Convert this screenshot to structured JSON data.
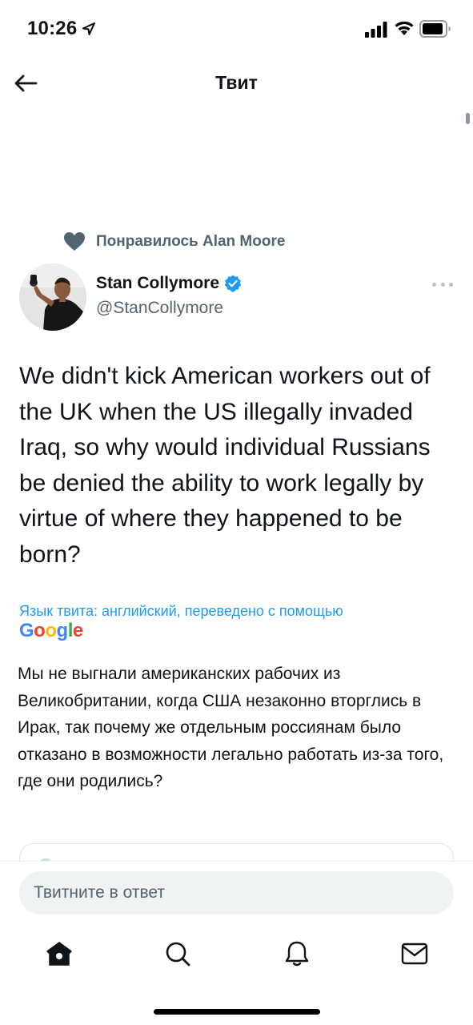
{
  "status_bar": {
    "time": "10:26"
  },
  "header": {
    "title": "Твит"
  },
  "social_context": {
    "liked_text": "Понравилось Alan Moore"
  },
  "author": {
    "name": "Stan Collymore",
    "handle": "@StanCollymore",
    "verified": true
  },
  "tweet": {
    "text": "We didn't kick American workers out of the UK when the US illegally invaded Iraq, so why would individual Russians be denied the ability to work legally by virtue of where they happened to be born?"
  },
  "translation": {
    "label": "Язык твита: английский, переведено с помощью",
    "provider": "Google",
    "text": "Мы не выгнали американских рабочих из Великобритании, когда США незаконно вторглись в Ирак, так почему же отдельным россиянам было отказано в возможности легально работать из-за того, где они родились?"
  },
  "reply": {
    "placeholder": "Твитните в ответ"
  },
  "nav": {
    "items": [
      "home-icon",
      "search-icon",
      "notifications-icon",
      "messages-icon"
    ]
  },
  "colors": {
    "accent": "#1d9bf0",
    "secondary_text": "#536471"
  }
}
